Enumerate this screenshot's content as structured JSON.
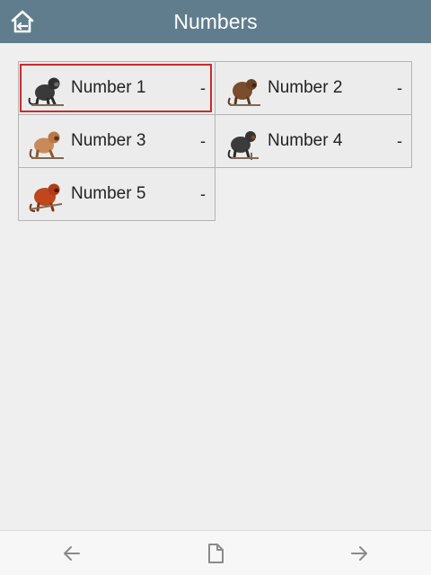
{
  "header": {
    "title": "Numbers",
    "home_icon": "home-back-icon",
    "bg_color": "#5f7d8c"
  },
  "items": [
    {
      "label": "Number 1",
      "value": "-",
      "icon": "black-monkey-icon",
      "selected": true
    },
    {
      "label": "Number 2",
      "value": "-",
      "icon": "brown-monkey-icon",
      "selected": false
    },
    {
      "label": "Number 3",
      "value": "-",
      "icon": "light-brown-monkey-icon",
      "selected": false
    },
    {
      "label": "Number 4",
      "value": "-",
      "icon": "dark-monkey-icon",
      "selected": false
    },
    {
      "label": "Number 5",
      "value": "-",
      "icon": "red-monkey-icon",
      "selected": false
    }
  ],
  "footer": {
    "back_icon": "arrow-left-icon",
    "page_icon": "document-icon",
    "forward_icon": "arrow-right-icon"
  },
  "colors": {
    "selection": "#cc2a2a"
  }
}
